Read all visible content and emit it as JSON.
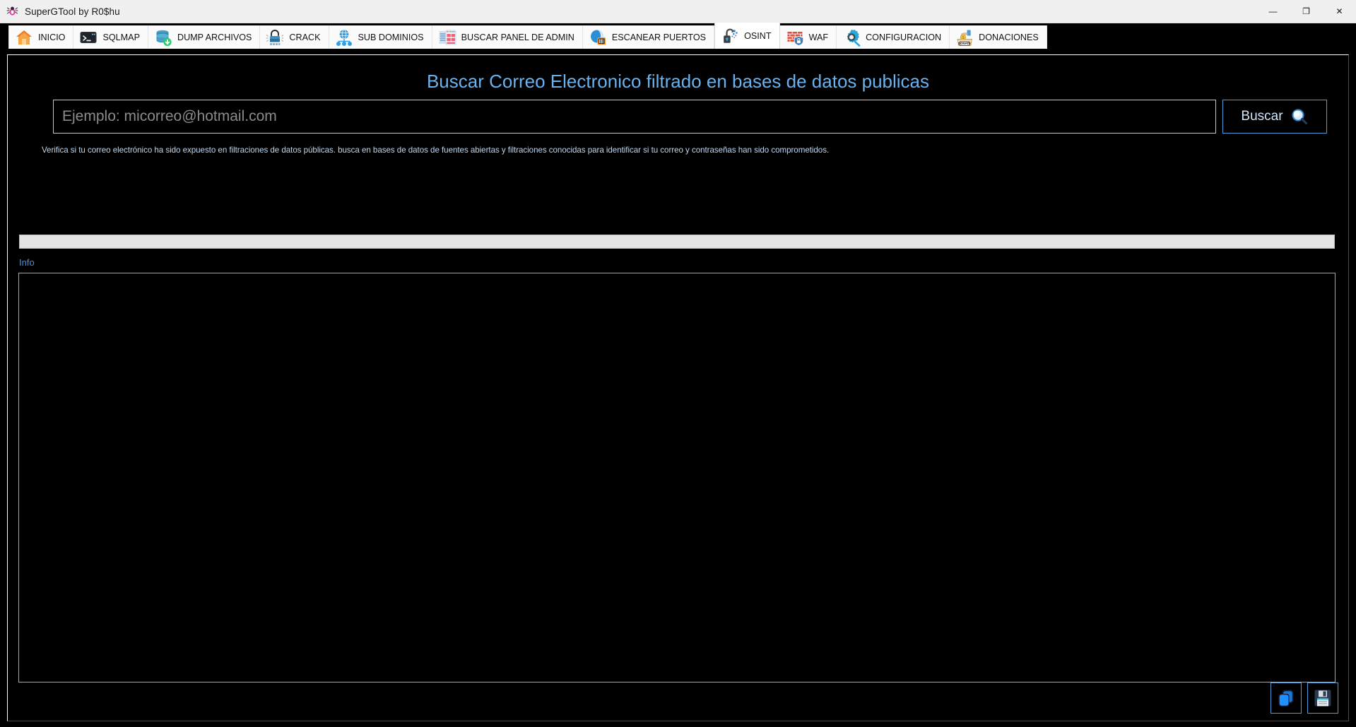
{
  "window": {
    "title": "SuperGTool by R0$hu",
    "app_icon": "spider-icon",
    "controls": {
      "minimize": "—",
      "maximize": "❐",
      "close": "✕"
    }
  },
  "tabs": [
    {
      "label": "INICIO",
      "icon": "house-icon",
      "active": false
    },
    {
      "label": "SQLMAP",
      "icon": "terminal-icon",
      "active": false
    },
    {
      "label": "DUMP ARCHIVOS",
      "icon": "database-down-icon",
      "active": false
    },
    {
      "label": "CRACK",
      "icon": "padlock-crack-icon",
      "active": false
    },
    {
      "label": "SUB DOMINIOS",
      "icon": "globe-network-icon",
      "active": false
    },
    {
      "label": "BUSCAR PANEL DE ADMIN",
      "icon": "browser-window-icon",
      "active": false
    },
    {
      "label": "ESCANEAR PUERTOS",
      "icon": "globe-scan-icon",
      "active": false
    },
    {
      "label": "OSINT",
      "icon": "unlock-data-icon",
      "active": true
    },
    {
      "label": "WAF",
      "icon": "firewall-icon",
      "active": false
    },
    {
      "label": "CONFIGURACION",
      "icon": "gear-icon",
      "active": false
    },
    {
      "label": "DONACIONES",
      "icon": "donate-box-icon",
      "active": false
    }
  ],
  "main": {
    "page_title": "Buscar Correo Electronico filtrado en bases de datos publicas",
    "search": {
      "value": "",
      "placeholder": "Ejemplo: micorreo@hotmail.com",
      "button_label": "Buscar",
      "button_icon": "search-icon"
    },
    "description": "Verifica si tu correo electrónico ha sido expuesto en filtraciones de datos públicas. busca en bases de datos de fuentes abiertas y filtraciones conocidas para identificar si tu correo y contraseñas han sido comprometidos.",
    "progress": {
      "value": 0
    },
    "info_label": "Info",
    "output_text": "",
    "actions": [
      {
        "name": "copy-button",
        "icon": "copy-icon"
      },
      {
        "name": "save-button",
        "icon": "floppy-save-icon"
      }
    ]
  },
  "colors": {
    "accent_blue": "#68b2f0",
    "button_border": "#4f9bd8",
    "info_blue": "#4a90d9",
    "background": "#000000",
    "titlebar": "#f0f0f0"
  }
}
